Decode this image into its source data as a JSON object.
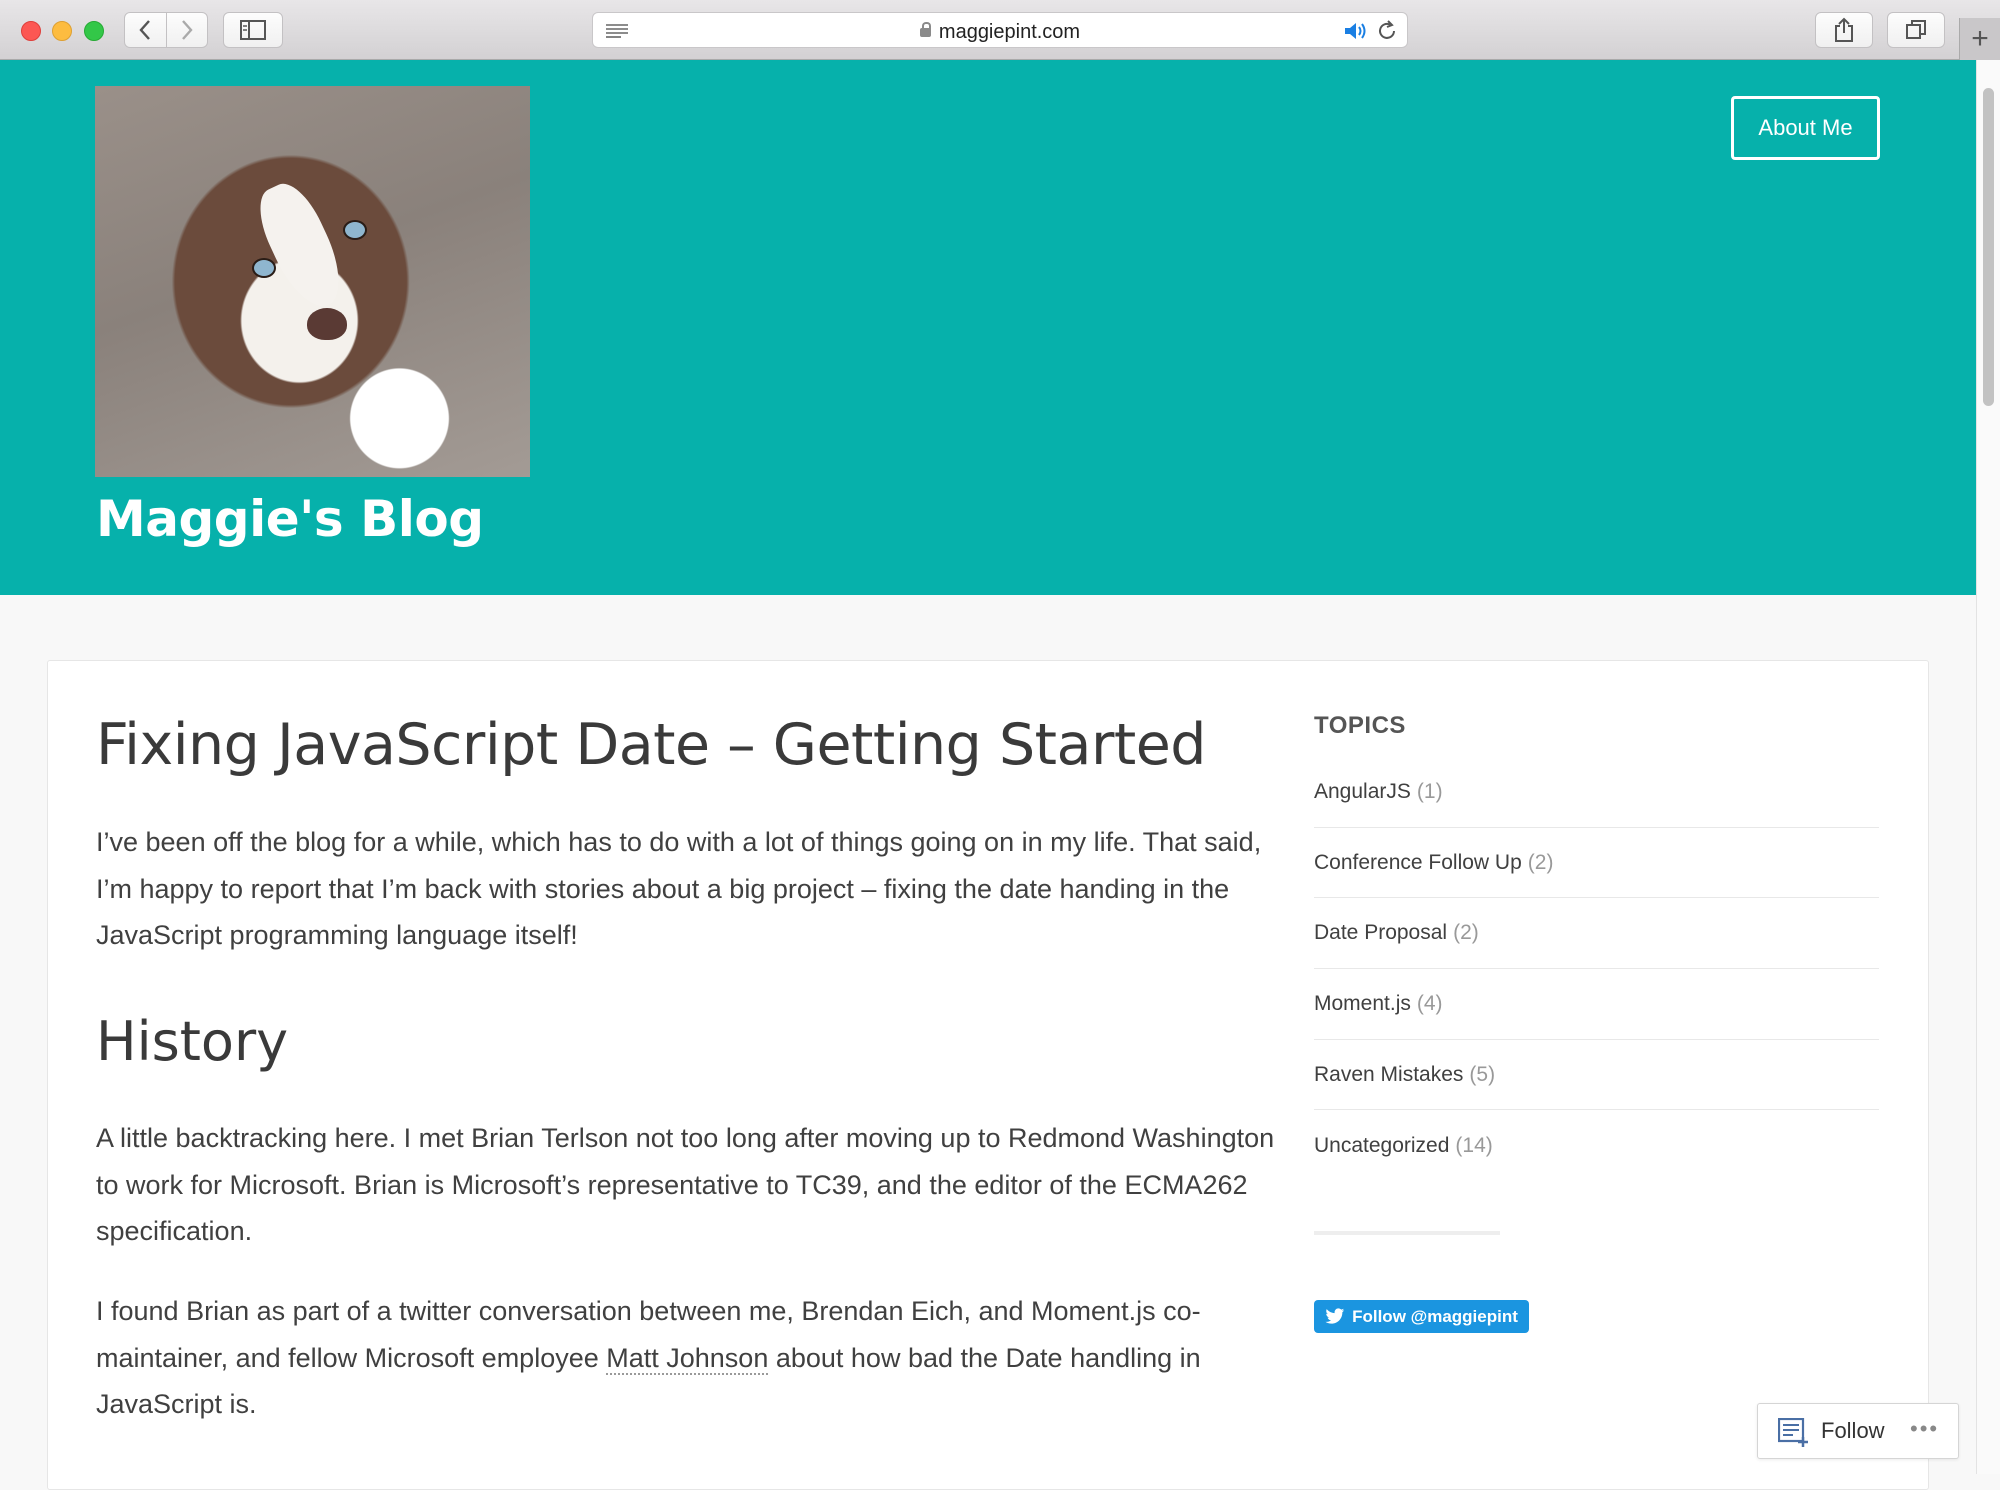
{
  "browser": {
    "url": "maggiepint.com"
  },
  "header": {
    "site_title": "Maggie's Blog",
    "nav_about": "About Me"
  },
  "article": {
    "title": "Fixing JavaScript Date – Getting Started",
    "intro": "I’ve been off the blog for a while, which has to do with a lot of things going on in my life. That said, I’m happy to report that I’m back with stories about a big project – fixing the date handing in the JavaScript programming language itself!",
    "history_heading": "History",
    "history_p1": "A little backtracking here. I met Brian Terlson not too long after moving up to Redmond Washington to work for Microsoft. Brian is Microsoft’s representative to TC39, and the editor of the ECMA262 specification.",
    "history_p2_before": "I found Brian as part of a twitter conversation between me, Brendan Eich, and Moment.js co-maintainer, and fellow Microsoft employee ",
    "history_p2_link": "Matt Johnson",
    "history_p2_after": " about how bad the Date handling in JavaScript is."
  },
  "sidebar": {
    "topics_title": "TOPICS",
    "topics": [
      {
        "label": "AngularJS",
        "count": "(1)"
      },
      {
        "label": "Conference Follow Up",
        "count": "(2)"
      },
      {
        "label": "Date Proposal",
        "count": "(2)"
      },
      {
        "label": "Moment.js",
        "count": "(4)"
      },
      {
        "label": "Raven Mistakes",
        "count": "(5)"
      },
      {
        "label": "Uncategorized",
        "count": "(14)"
      }
    ],
    "twitter_follow": "Follow @maggiepint"
  },
  "follow_bar": {
    "label": "Follow",
    "more": "•••"
  },
  "colors": {
    "header_bg": "#06b1ab",
    "twitter_blue": "#1b95e0"
  }
}
